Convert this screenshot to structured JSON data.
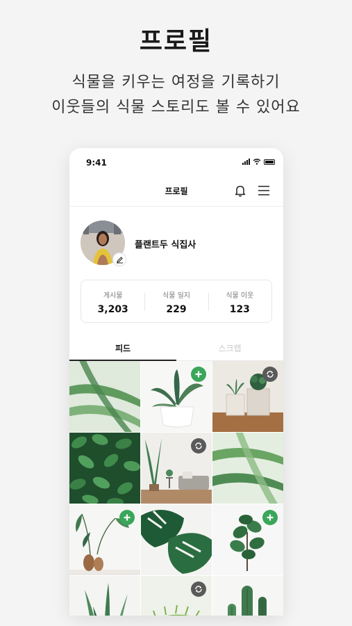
{
  "promo": {
    "headline": "프로필",
    "subline_1": "식물을 키우는 여정을 기록하기",
    "subline_2": "이웃들의 식물 스토리도 볼 수 있어요"
  },
  "status_bar": {
    "time": "9:41"
  },
  "app_bar": {
    "title": "프로필",
    "icons": [
      "bell-icon",
      "menu-icon"
    ]
  },
  "profile": {
    "nickname": "플랜트두 식집사",
    "edit_icon": "pencil-icon"
  },
  "stats": [
    {
      "label": "게시물",
      "value": "3,203"
    },
    {
      "label": "식물 일지",
      "value": "229"
    },
    {
      "label": "식물 이웃",
      "value": "123"
    }
  ],
  "tabs": [
    {
      "label": "피드",
      "active": true
    },
    {
      "label": "스크랩",
      "active": false
    }
  ],
  "feed_grid": [
    {
      "subject": "palm leaves",
      "badge": "none"
    },
    {
      "subject": "potted aloe in white pot",
      "badge": "plus"
    },
    {
      "subject": "succulents on wooden shelf",
      "badge": "repost"
    },
    {
      "subject": "dense green leaves",
      "badge": "none"
    },
    {
      "subject": "living room with plants",
      "badge": "repost"
    },
    {
      "subject": "palm leaves",
      "badge": "none"
    },
    {
      "subject": "plant stems in wooden vases",
      "badge": "plus"
    },
    {
      "subject": "monstera leaves",
      "badge": "none"
    },
    {
      "subject": "fiddle leaf fig",
      "badge": "plus"
    },
    {
      "subject": "snake plant",
      "badge": "none"
    },
    {
      "subject": "fern",
      "badge": "repost"
    },
    {
      "subject": "cactus",
      "badge": "none"
    }
  ],
  "colors": {
    "accent_green": "#3aa65a",
    "repost_gray": "#5a5a5a",
    "background": "#f4f4f4"
  }
}
